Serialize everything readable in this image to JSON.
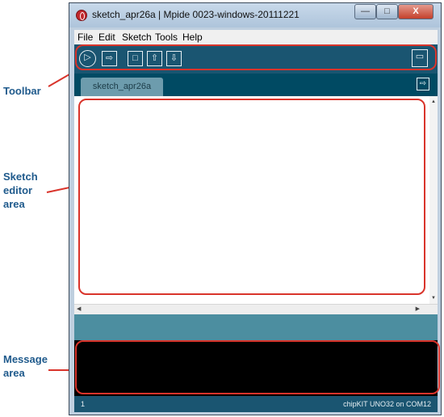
{
  "window": {
    "title": "sketch_apr26a | Mpide 0023-windows-20111221",
    "controls": {
      "minimize": "—",
      "maximize": "□",
      "close": "X"
    }
  },
  "menu": [
    "File",
    "Edit",
    "Sketch",
    "Tools",
    "Help"
  ],
  "toolbar": {
    "icons": {
      "verify": "▷",
      "upload": "⇨",
      "new": "□",
      "open": "⇧",
      "save": "⇩",
      "serial_monitor": "▭"
    }
  },
  "tabs": [
    {
      "label": "sketch_apr26a"
    }
  ],
  "tab_menu_icon": "⇨",
  "editor": {
    "content": ""
  },
  "status": {
    "line_number": "1",
    "board": "chipKIT UNO32 on COM12"
  },
  "annotations": {
    "toolbar": "Toolbar",
    "sketch_editor": "Sketch editor area",
    "message_area": "Message area"
  },
  "colors": {
    "toolbar_bg": "#1a5571",
    "tab_bg": "#6d9cad",
    "console_bg": "#000000",
    "highlight": "#d9342b",
    "annotation_text": "#1f5a8c"
  }
}
